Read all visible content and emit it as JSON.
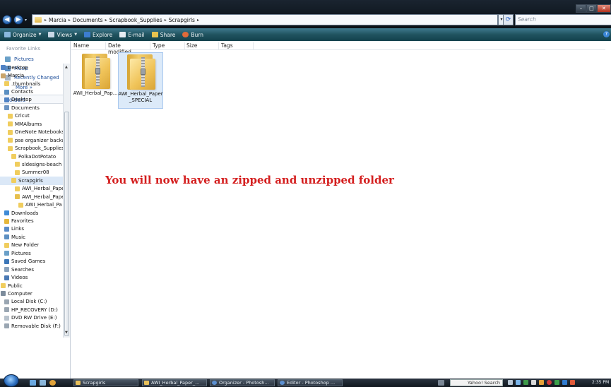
{
  "address": {
    "breadcrumbs": [
      "Marcia",
      "Documents",
      "Scrapbook_Supplies",
      "Scrapgirls"
    ],
    "search_placeholder": "Search"
  },
  "toolbar": {
    "organize": "Organize",
    "views": "Views",
    "explore": "Explore",
    "email": "E-mail",
    "share": "Share",
    "burn": "Burn"
  },
  "navpane": {
    "favorites_header": "Favorite Links",
    "favorites": [
      "Pictures",
      "Music",
      "Recently Changed"
    ],
    "more": "More »",
    "folders_label": "Folders",
    "tree": [
      {
        "label": "Desktop",
        "indent": 0,
        "icon": "desktop"
      },
      {
        "label": "Marcia",
        "indent": 0,
        "icon": "user"
      },
      {
        "label": ".thumbnails",
        "indent": 1,
        "icon": "folder"
      },
      {
        "label": "Contacts",
        "indent": 1,
        "icon": "contacts"
      },
      {
        "label": "Desktop",
        "indent": 1,
        "icon": "desktop"
      },
      {
        "label": "Documents",
        "indent": 1,
        "icon": "documents"
      },
      {
        "label": "Cricut",
        "indent": 2,
        "icon": "folder"
      },
      {
        "label": "MMAlbums",
        "indent": 2,
        "icon": "folder"
      },
      {
        "label": "OneNote Notebooks",
        "indent": 2,
        "icon": "folder"
      },
      {
        "label": "pse organizer backup",
        "indent": 2,
        "icon": "folder"
      },
      {
        "label": "Scrapbook_Supplies",
        "indent": 2,
        "icon": "folder"
      },
      {
        "label": "PolkaDotPotato",
        "indent": 3,
        "icon": "folder"
      },
      {
        "label": "sldesigns-beach",
        "indent": 4,
        "icon": "folder"
      },
      {
        "label": "Summer08",
        "indent": 4,
        "icon": "folder"
      },
      {
        "label": "Scrapgirls",
        "indent": 3,
        "icon": "folder",
        "selected": true
      },
      {
        "label": "AWI_Herbal_Paper",
        "indent": 4,
        "icon": "folder"
      },
      {
        "label": "AWI_Herbal_Paper",
        "indent": 4,
        "icon": "zip"
      },
      {
        "label": "AWI_Herbal_Pa",
        "indent": 5,
        "icon": "folder"
      },
      {
        "label": "Downloads",
        "indent": 1,
        "icon": "downloads"
      },
      {
        "label": "Favorites",
        "indent": 1,
        "icon": "favorites"
      },
      {
        "label": "Links",
        "indent": 1,
        "icon": "links"
      },
      {
        "label": "Music",
        "indent": 1,
        "icon": "music"
      },
      {
        "label": "New Folder",
        "indent": 1,
        "icon": "folder"
      },
      {
        "label": "Pictures",
        "indent": 1,
        "icon": "pictures"
      },
      {
        "label": "Saved Games",
        "indent": 1,
        "icon": "games"
      },
      {
        "label": "Searches",
        "indent": 1,
        "icon": "searches"
      },
      {
        "label": "Videos",
        "indent": 1,
        "icon": "videos"
      },
      {
        "label": "Public",
        "indent": 0,
        "icon": "folder"
      },
      {
        "label": "Computer",
        "indent": 0,
        "icon": "computer"
      },
      {
        "label": "Local Disk (C:)",
        "indent": 1,
        "icon": "disk"
      },
      {
        "label": "HP_RECOVERY (D:)",
        "indent": 1,
        "icon": "disk"
      },
      {
        "label": "DVD RW Drive (E:)",
        "indent": 1,
        "icon": "dvd"
      },
      {
        "label": "Removable Disk (F:)",
        "indent": 1,
        "icon": "disk"
      }
    ]
  },
  "columns": [
    "Name",
    "Date modified",
    "Type",
    "Size",
    "Tags"
  ],
  "files": [
    {
      "name": "AWI_Herbal_Pap...",
      "selected": false
    },
    {
      "name": "AWI_Herbal_Paper\n_SPECIAL",
      "selected": true
    }
  ],
  "annotation": "You will now have an zipped and unzipped folder",
  "taskbar": {
    "buttons": [
      "Scrapgirls",
      "AWI_Herbal_Paper_...",
      "Organizer - Photosh...",
      "Editor - Photoshop ..."
    ],
    "search_label": "Yahoo! Search",
    "clock": "2:35 PM"
  },
  "colors": {
    "annotation": "#d41f1f",
    "link": "#1e4f9a",
    "selection": "#dceaf9"
  }
}
